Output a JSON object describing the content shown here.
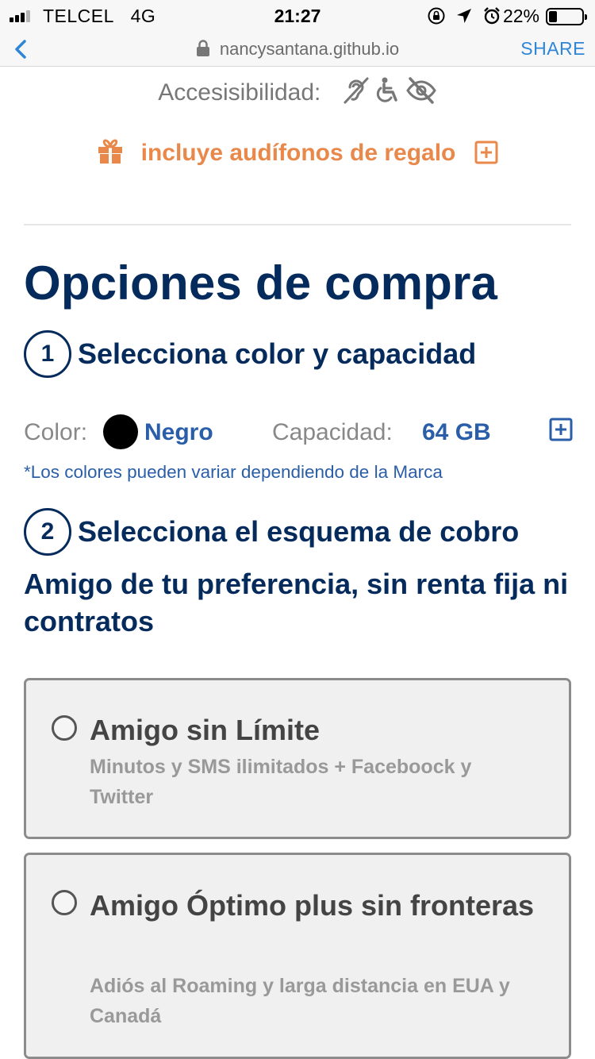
{
  "status_bar": {
    "carrier": "TELCEL",
    "network": "4G",
    "time": "21:27",
    "battery": "22%",
    "battery_level": 0.22
  },
  "browser": {
    "url": "nancysantana.github.io",
    "share_label": "SHARE"
  },
  "accessibility": {
    "label": "Accesisibilidad:",
    "icons": [
      "hearing-impaired-icon",
      "wheelchair-icon",
      "visually-impaired-icon"
    ]
  },
  "gift": {
    "text": "incluye audífonos de regalo",
    "color": "#e8894b"
  },
  "page_title": "Opciones de compra",
  "step1": {
    "number": "1",
    "title": "Selecciona color y capacidad"
  },
  "options": {
    "color_label": "Color:",
    "color_value": "Negro",
    "capacity_label": "Capacidad:",
    "capacity_value": "64 GB",
    "note": "*Los colores pueden variar dependiendo de la Marca"
  },
  "step2": {
    "number": "2",
    "title": "Selecciona el esquema de cobro"
  },
  "subheading": "Amigo de tu preferencia, sin renta fija ni contratos",
  "plans": [
    {
      "title": "Amigo sin Límite",
      "description": "Minutos y SMS ilimitados + Faceboock y Twitter"
    },
    {
      "title": "Amigo Óptimo plus sin fronteras",
      "description": "Adiós al Roaming y larga distancia en EUA y Canadá"
    }
  ],
  "colors": {
    "navy": "#052b5c",
    "blue": "#2a5ea8",
    "orange": "#e8894b",
    "link": "#2f86d6"
  }
}
